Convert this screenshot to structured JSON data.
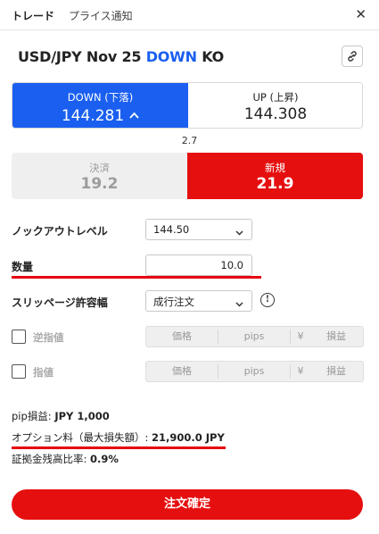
{
  "tabs": [
    {
      "label": "トレード",
      "active": true
    },
    {
      "label": "プライス通知",
      "active": false
    }
  ],
  "close_icon": "close-icon",
  "product": {
    "pair": "USD/JPY Nov 25",
    "direction": "DOWN",
    "suffix": "KO",
    "direction_color": "#1a5ff0",
    "link_icon": "link-icon"
  },
  "quotes": {
    "down": {
      "label": "DOWN (下落)",
      "price": "144.281",
      "trend_icon": "caret-up-icon",
      "color": "#1a5ff0"
    },
    "up": {
      "label": "UP (上昇)",
      "price": "144.308"
    }
  },
  "spread": "2.7",
  "sides": {
    "settle": {
      "label": "決済",
      "value": "19.2"
    },
    "new": {
      "label": "新規",
      "value": "21.9",
      "color": "#e60f0f"
    }
  },
  "form": {
    "knockout": {
      "label": "ノックアウトレベル",
      "value": "144.50"
    },
    "quantity": {
      "label": "数量",
      "value": "10.0"
    },
    "slippage": {
      "label": "スリッページ許容幅",
      "value": "成行注文",
      "info": "!"
    },
    "stop": {
      "label": "逆指値",
      "price": "価格",
      "pips": "pips",
      "yen": "¥",
      "pl": "損益"
    },
    "limit": {
      "label": "指値",
      "price": "価格",
      "pips": "pips",
      "yen": "¥",
      "pl": "損益"
    }
  },
  "summary": {
    "pip_label": "pip損益: ",
    "pip_value": "JPY 1,000",
    "option_label": "オプション料（最大損失額）: ",
    "option_value": "21,900.0 JPY",
    "margin_label": "証拠金残高比率: ",
    "margin_value": "0.9%"
  },
  "confirm_label": "注文確定",
  "annotation_color": "#e60012"
}
